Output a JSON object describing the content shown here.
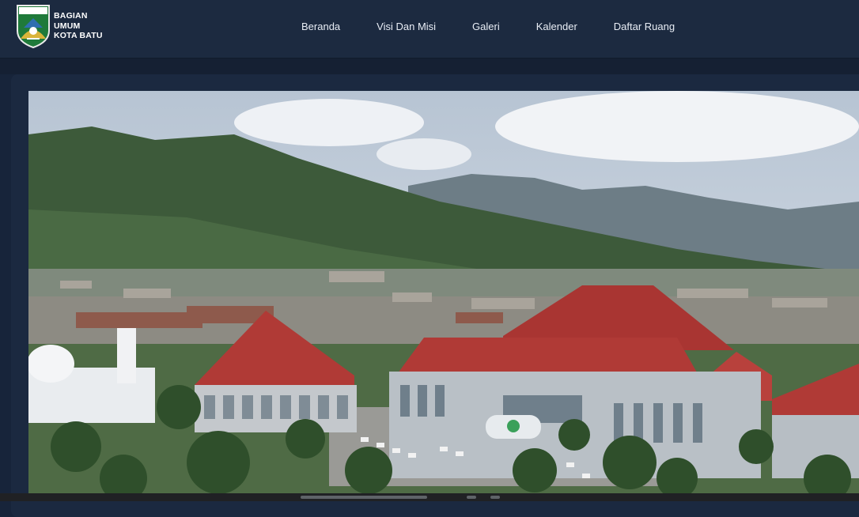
{
  "brand": {
    "logo_text": "KOTA BATU",
    "line1": "BAGIAN",
    "line2": "UMUM",
    "line3": "KOTA BATU"
  },
  "nav": {
    "items": [
      "Beranda",
      "Visi Dan Misi",
      "Galeri",
      "Kalender",
      "Daftar Ruang"
    ]
  },
  "hero": {
    "icon": "aerial-photo-city-hall",
    "roof_color": "#b03a36",
    "sky_color": "#cdd6e0",
    "mountain_color": "#3d5a3a"
  },
  "colors": {
    "navbar": "#1c2a40",
    "background": "#17243a",
    "text": "#e8edf5"
  }
}
